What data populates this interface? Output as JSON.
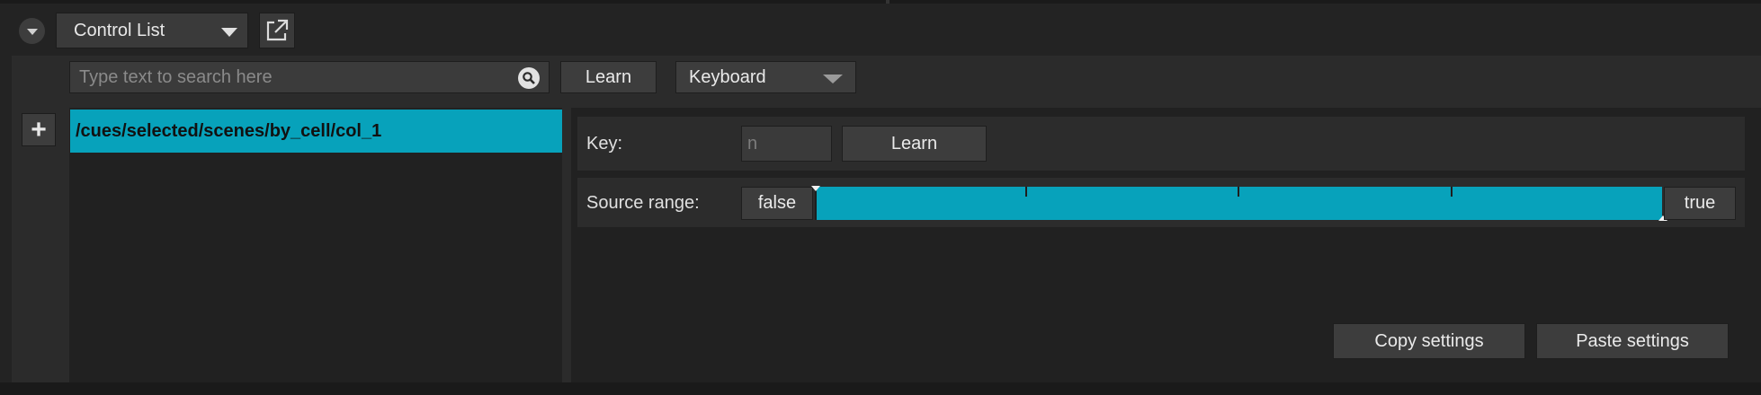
{
  "header": {
    "view_dropdown": "Control List"
  },
  "toolbar": {
    "search_placeholder": "Type text to search here",
    "learn_label": "Learn",
    "input_type": "Keyboard"
  },
  "list": {
    "items": [
      {
        "label": "/cues/selected/scenes/by_cell/col_1",
        "selected": true
      }
    ]
  },
  "detail": {
    "key_label": "Key:",
    "key_value": "n",
    "key_learn_label": "Learn",
    "source_range_label": "Source range:",
    "range_min_label": "false",
    "range_max_label": "true",
    "range_fill": 1.0,
    "copy_label": "Copy settings",
    "paste_label": "Paste settings"
  },
  "colors": {
    "accent": "#07a2bb",
    "background": "#232323",
    "panel": "#2b2b2b",
    "button": "#3d3d3d"
  },
  "icons": {
    "collapse": "chevron-down-icon",
    "popout": "external-link-icon",
    "search": "search-icon",
    "add": "plus-icon"
  }
}
